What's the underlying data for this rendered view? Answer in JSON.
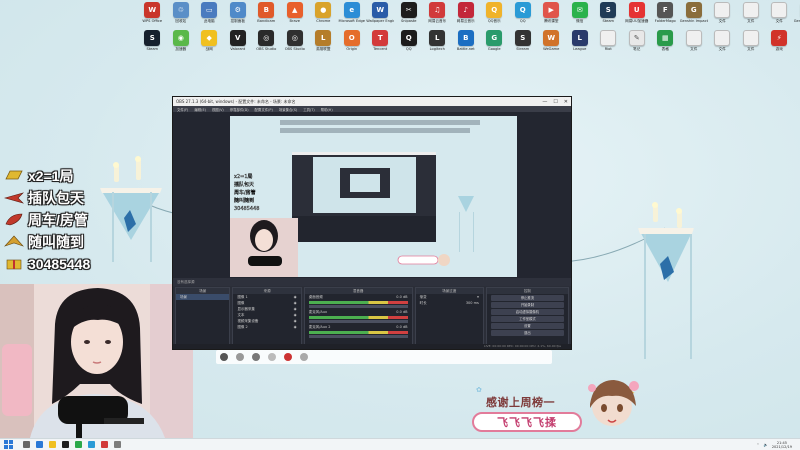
{
  "desktop": {
    "row1": [
      {
        "label": "WPS Office",
        "color": "#c9362b",
        "glyph": "W"
      },
      {
        "label": "回收站",
        "color": "#5b8fc7",
        "glyph": "♲"
      },
      {
        "label": "此电脑",
        "color": "#4a7bbf",
        "glyph": "▭"
      },
      {
        "label": "控制面板",
        "color": "#4f8ac9",
        "glyph": "⚙"
      },
      {
        "label": "Bandicam",
        "color": "#e05a2a",
        "glyph": "B"
      },
      {
        "label": "Brave",
        "color": "#e8602c",
        "glyph": "▲"
      },
      {
        "label": "Chrome",
        "color": "#d9a32b",
        "glyph": "●"
      },
      {
        "label": "Microsoft Edge",
        "color": "#2b8dd6",
        "glyph": "e"
      },
      {
        "label": "Wallpaper Engine",
        "color": "#2a5ca8",
        "glyph": "W"
      },
      {
        "label": "Snipaste",
        "color": "#1d1d1d",
        "glyph": "✂"
      },
      {
        "label": "网易云音乐",
        "color": "#d13a3a",
        "glyph": "♫"
      },
      {
        "label": "网易云音乐",
        "color": "#c3283a",
        "glyph": "♪"
      },
      {
        "label": "QQ音乐",
        "color": "#f0b32a",
        "glyph": "Q"
      },
      {
        "label": "QQ",
        "color": "#2a9bd6",
        "glyph": "Q"
      },
      {
        "label": "腾讯课堂",
        "color": "#e0554b",
        "glyph": "▶"
      },
      {
        "label": "微信",
        "color": "#2bb24c",
        "glyph": "✉"
      },
      {
        "label": "Steam",
        "color": "#1f3b57",
        "glyph": "S"
      },
      {
        "label": "网易UU加速器",
        "color": "#e53333",
        "glyph": "U"
      },
      {
        "label": "FolderMago",
        "color": "#555",
        "glyph": "F"
      },
      {
        "label": "Genshin Impact",
        "color": "#8a6d3b",
        "glyph": "G"
      },
      {
        "label": "文件",
        "color": "#f0f0f0",
        "glyph": ""
      },
      {
        "label": "文件",
        "color": "#f0f0f0",
        "glyph": ""
      },
      {
        "label": "文件",
        "color": "#f0f0f0",
        "glyph": ""
      },
      {
        "label": "Genshin Impact",
        "color": "#6b4a2b",
        "glyph": "G"
      }
    ],
    "row2": [
      {
        "label": "Steam",
        "color": "#16202d",
        "glyph": "S"
      },
      {
        "label": "加速器",
        "color": "#5ab84a",
        "glyph": "◉"
      },
      {
        "label": "战网",
        "color": "#f0c020",
        "glyph": "◆"
      },
      {
        "label": "Valorant",
        "color": "#222",
        "glyph": "V"
      },
      {
        "label": "OBS Studio",
        "color": "#2a2a2a",
        "glyph": "◎"
      },
      {
        "label": "OBS Studio",
        "color": "#303030",
        "glyph": "◎"
      },
      {
        "label": "英雄联盟",
        "color": "#b57d2a",
        "glyph": "L"
      },
      {
        "label": "Origin",
        "color": "#e56d2b",
        "glyph": "O"
      },
      {
        "label": "Tencent",
        "color": "#d33a3a",
        "glyph": "T"
      },
      {
        "label": "QQ",
        "color": "#1c1c1c",
        "glyph": "Q"
      },
      {
        "label": "Logitech",
        "color": "#333",
        "glyph": "L"
      },
      {
        "label": "Battle.net",
        "color": "#1b6ec2",
        "glyph": "B"
      },
      {
        "label": "Google",
        "color": "#2a9b6b",
        "glyph": "G"
      },
      {
        "label": "Stream",
        "color": "#333",
        "glyph": "S"
      },
      {
        "label": "WeGame",
        "color": "#d1732a",
        "glyph": "W"
      },
      {
        "label": "League",
        "color": "#2a3b6b",
        "glyph": "L"
      },
      {
        "label": "Riot",
        "color": "#f0f0f0",
        "glyph": ""
      },
      {
        "label": "笔记",
        "color": "#e8e8e8",
        "glyph": "✎"
      },
      {
        "label": "表格",
        "color": "#2a9b4a",
        "glyph": "▦"
      },
      {
        "label": "文件",
        "color": "#f0f0f0",
        "glyph": ""
      },
      {
        "label": "文件",
        "color": "#f0f0f0",
        "glyph": ""
      },
      {
        "label": "文件",
        "color": "#f0f0f0",
        "glyph": ""
      },
      {
        "label": "游戏",
        "color": "#d1332a",
        "glyph": "⚡"
      }
    ]
  },
  "promo": {
    "lines": [
      {
        "text": "x2=1局",
        "icon": "gold-bar-icon",
        "color": "#e0b830"
      },
      {
        "text": "插队包天",
        "icon": "airplane-icon",
        "color": "#c0392b"
      },
      {
        "text": "周车/房管",
        "icon": "rocket-icon",
        "color": "#c0392b"
      },
      {
        "text": "随叫随到",
        "icon": "spaceship-icon",
        "color": "#d4a030"
      },
      {
        "text": "30485448",
        "icon": "gift-icon",
        "color": "#e0b830"
      }
    ]
  },
  "obs": {
    "title": "OBS 27.1.3 (64-bit, windows) - 配置文件: 未命名 - 场景: 未命名",
    "menu": [
      "文件(F)",
      "编辑(E)",
      "视图(V)",
      "停靠部件(D)",
      "配置文件(P)",
      "场景集合(S)",
      "工具(T)",
      "帮助(H)"
    ],
    "scene_bar_label": "没有选择源",
    "docks": {
      "scenes_title": "场景",
      "sources_title": "来源",
      "sources": [
        "图像 1",
        "图像",
        "显示器采集",
        "文本",
        "视频采集设备",
        "图像 2"
      ],
      "mixer_title": "混音器",
      "mixer_items": [
        "桌面音频",
        "麦克风/Aux",
        "麦克风/Aux 2"
      ],
      "mixer_level": "0.0 dB",
      "transitions_title": "场景过渡",
      "transition_value": "渐变",
      "duration_label": "时长",
      "duration_value": "300 ms",
      "controls_title": "控制",
      "controls": [
        "停止推流",
        "开始录制",
        "启动虚拟摄像机",
        "工作室模式",
        "设置",
        "退出"
      ]
    },
    "status": "LIVE: 00:00:00  REC: 00:00:00  CPU: 2.1%, 60.00 fps"
  },
  "sticker": {
    "line1": "感谢上周榜一",
    "line2": "飞飞飞飞揉"
  },
  "taskbar": {
    "time": "21:45",
    "date": "2021/12/19"
  }
}
